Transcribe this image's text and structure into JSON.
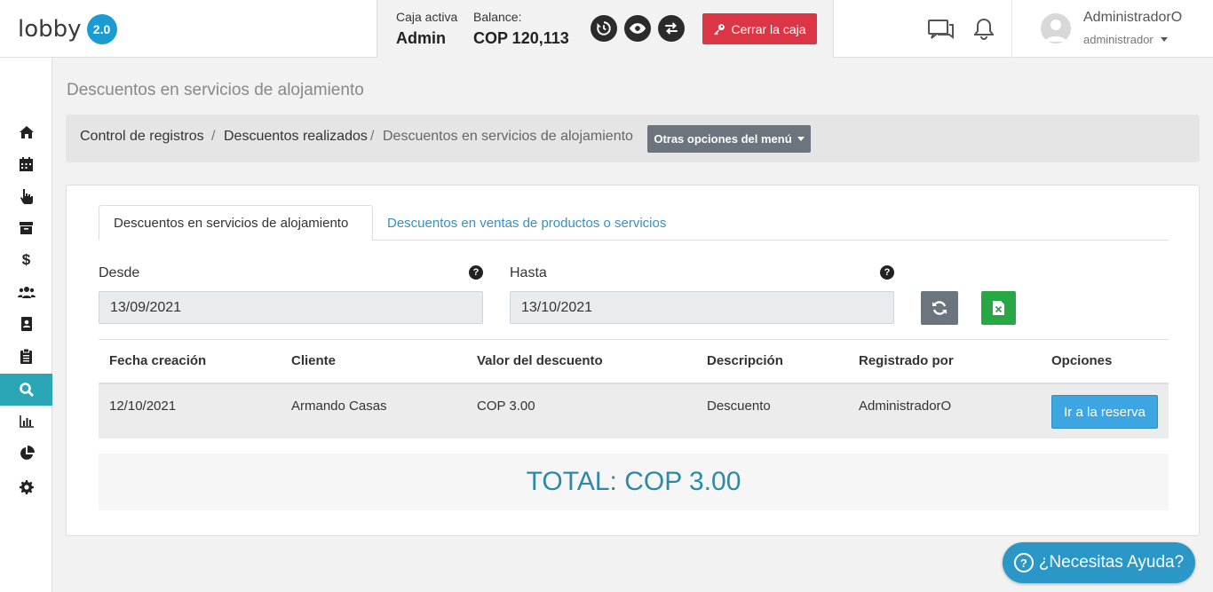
{
  "header": {
    "logo_text": "lobby",
    "version_badge": "2.0",
    "cash": {
      "active_label": "Caja activa",
      "active_value": "Admin",
      "balance_label": "Balance:",
      "balance_value": "COP 120,113",
      "close_button": "Cerrar la caja"
    },
    "user": {
      "name": "AdministradorO",
      "role": "administrador"
    }
  },
  "sidebar": {
    "active_index": 8,
    "items": [
      "home-icon",
      "calendar-icon",
      "pointer-icon",
      "archive-icon",
      "dollar-icon",
      "users-icon",
      "contact-book-icon",
      "clipboard-icon",
      "search-icon",
      "bar-chart-icon",
      "pie-chart-icon",
      "gear-icon"
    ]
  },
  "page": {
    "title": "Descuentos en servicios de alojamiento",
    "breadcrumb": [
      "Control de registros",
      "Descuentos realizados",
      "Descuentos en servicios de alojamiento"
    ],
    "menu_button": "Otras opciones del menú"
  },
  "tabs": [
    {
      "label": "Descuentos en servicios de alojamiento",
      "active": true
    },
    {
      "label": "Descuentos en ventas de productos o servicios",
      "active": false
    }
  ],
  "filters": {
    "from_label": "Desde",
    "from_value": "13/09/2021",
    "to_label": "Hasta",
    "to_value": "13/10/2021"
  },
  "table": {
    "columns": [
      "Fecha creación",
      "Cliente",
      "Valor del descuento",
      "Descripción",
      "Registrado por",
      "Opciones"
    ],
    "rows": [
      {
        "fecha": "12/10/2021",
        "cliente": "Armando Casas",
        "valor": "COP 3.00",
        "descripcion": "Descuento",
        "registrado": "AdministradorO",
        "accion": "Ir a la reserva"
      }
    ]
  },
  "total": "TOTAL: COP 3.00",
  "help_button": "¿Necesitas Ayuda?"
}
